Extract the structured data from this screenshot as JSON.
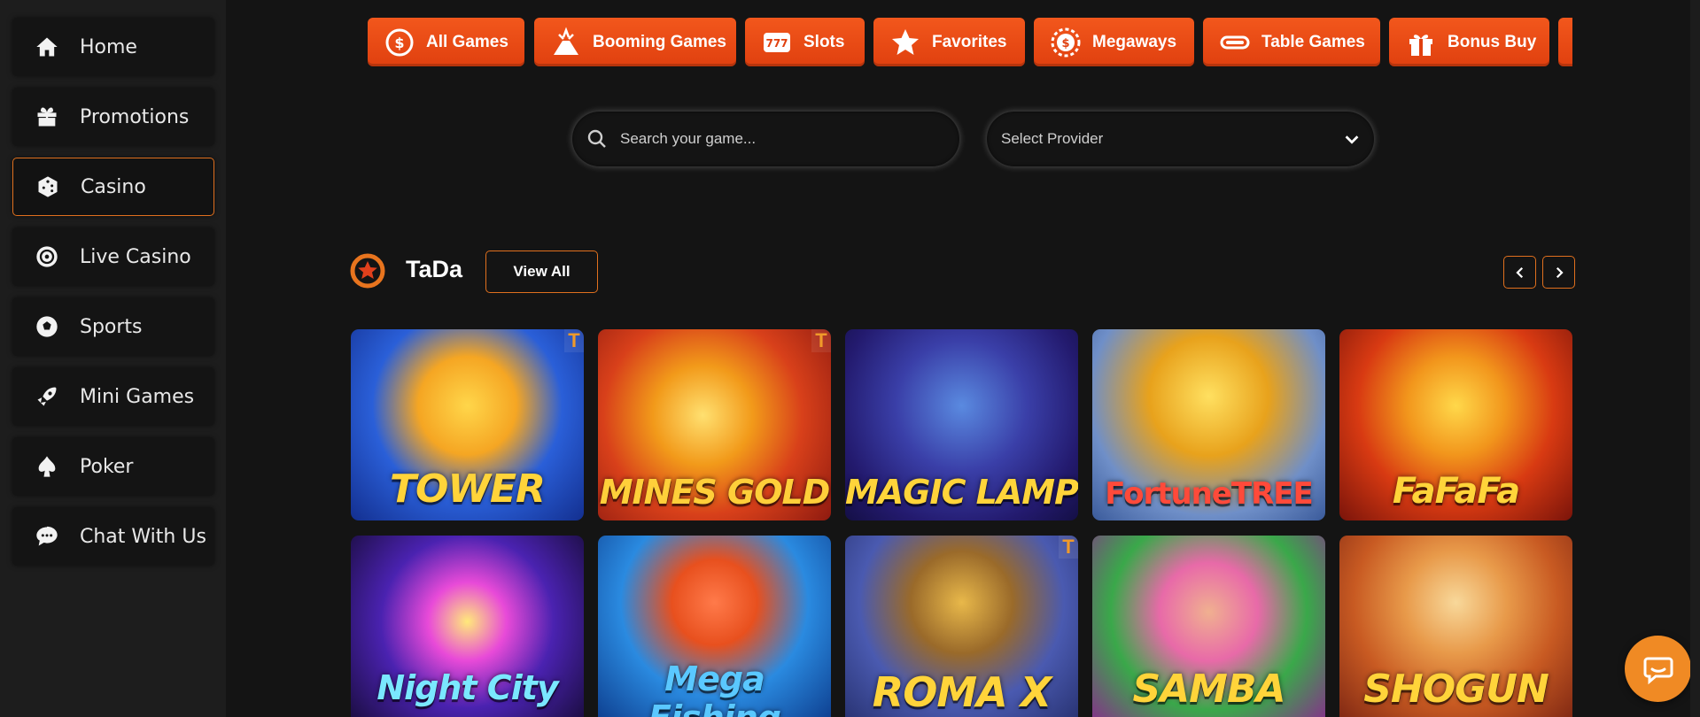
{
  "sidebar": {
    "items": [
      {
        "label": "Home",
        "icon": "home-icon"
      },
      {
        "label": "Promotions",
        "icon": "gift-icon"
      },
      {
        "label": "Casino",
        "icon": "dice-icon",
        "active": true
      },
      {
        "label": "Live Casino",
        "icon": "roulette-icon"
      },
      {
        "label": "Sports",
        "icon": "soccer-ball-icon"
      },
      {
        "label": "Mini Games",
        "icon": "rocket-icon"
      },
      {
        "label": "Poker",
        "icon": "spade-icon"
      },
      {
        "label": "Chat With Us",
        "icon": "chat-bubble-icon"
      }
    ]
  },
  "categories": [
    {
      "label": "All Games",
      "icon": "coin-dollar-icon"
    },
    {
      "label": "Booming Games",
      "icon": "volcano-icon"
    },
    {
      "label": "Slots",
      "icon": "slot-777-icon"
    },
    {
      "label": "Favorites",
      "icon": "star-icon"
    },
    {
      "label": "Megaways",
      "icon": "dollar-chip-icon"
    },
    {
      "label": "Table Games",
      "icon": "table-icon"
    },
    {
      "label": "Bonus Buy",
      "icon": "gift-box-icon"
    }
  ],
  "search": {
    "placeholder": "Search your game..."
  },
  "provider_select": {
    "value": "Select Provider"
  },
  "section": {
    "title": "TaDa",
    "view_all": "View All"
  },
  "games": [
    {
      "name": "TOWER",
      "badge": "T"
    },
    {
      "name": "MINES GOLD",
      "badge": "T"
    },
    {
      "name": "MAGIC LAMP",
      "badge": ""
    },
    {
      "name": "FortuneTREE",
      "badge": ""
    },
    {
      "name": "FaFaFa",
      "badge": ""
    },
    {
      "name": "Night City",
      "badge": ""
    },
    {
      "name": "Mega Fishing",
      "badge": ""
    },
    {
      "name": "ROMA X",
      "badge": "T"
    },
    {
      "name": "SAMBA",
      "badge": ""
    },
    {
      "name": "SHOGUN",
      "badge": ""
    }
  ],
  "colors": {
    "accent": "#e0701e",
    "category_bg": "#f2571c",
    "chat": "#f08a24"
  }
}
